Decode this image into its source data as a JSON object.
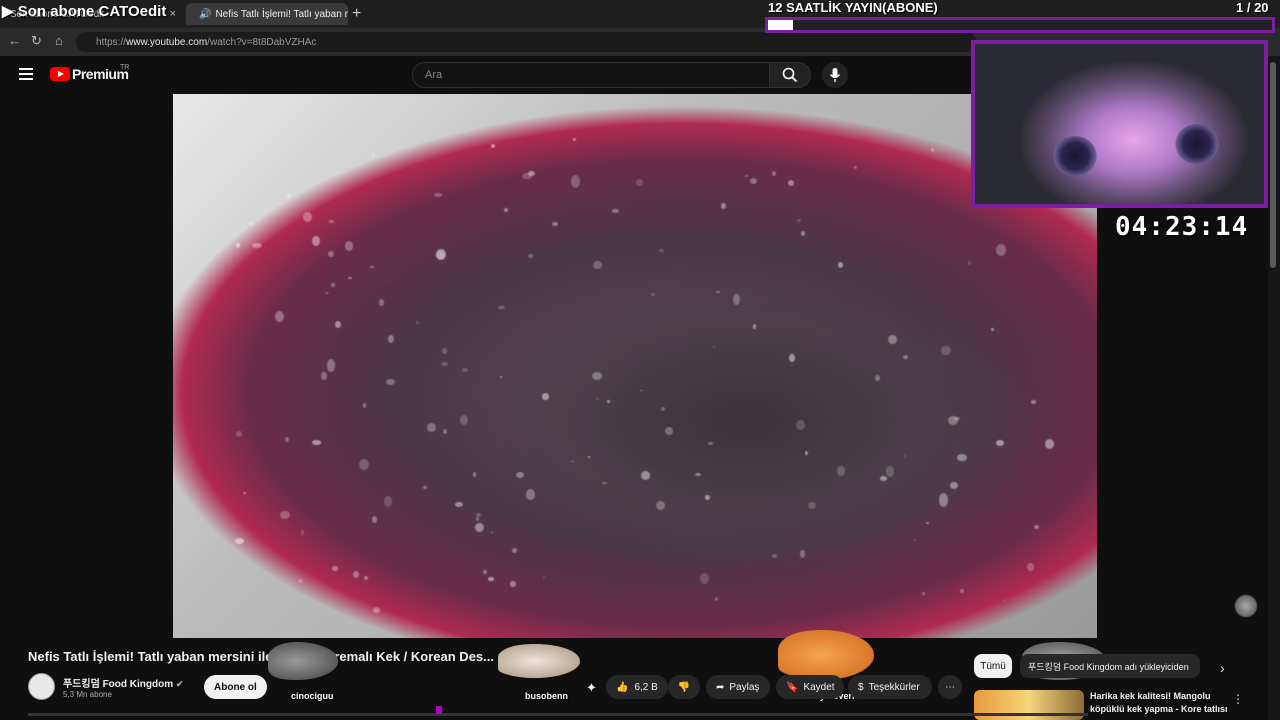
{
  "overlay": {
    "stream_text": "▶ Son abone CATOedit",
    "goal_title": "12 SAATLİK YAYIN(ABONE)",
    "goal_count": "1 / 20",
    "goal_progress": 0.05,
    "timer": "04:23:14"
  },
  "browser": {
    "tabs": [
      {
        "label": "Son abone CATOedit"
      },
      {
        "label": "Nefis Tatlı İşlemi! Tatlı yaban m"
      }
    ],
    "url_prefix": "https://",
    "url_host": "www.youtube.com",
    "url_path": "/watch?v=8t8DabVZHAc"
  },
  "youtube": {
    "logo": "Premium",
    "region": "TR",
    "search_placeholder": "Ara"
  },
  "video": {
    "title": "Nefis Tatlı İşlemi! Tatlı yaban mersini ile y... yurt Kremalı Kek / Korean Des... ry",
    "channel": "푸드킹덤 Food Kingdom",
    "subscribers": "5,3 Mn abone",
    "subscribe_label": "Abone ol",
    "likes": "6,2 B",
    "share_label": "Paylaş",
    "save_label": "Kaydet",
    "thanks_label": "Teşekkürler"
  },
  "overlay_cats": [
    "cinociguu",
    "busobenn",
    "seymoverr"
  ],
  "sidebar": {
    "chip_all": "Tümü",
    "chip_channel": "푸드킹덤 Food Kingdom adı yükleyiciden",
    "rec_title": "Harika kek kalitesi! Mangolu köpüklü kek yapma - Kore tatlısı"
  },
  "colors": {
    "accent": "#7b1fa2",
    "youtube_red": "#ff0000"
  }
}
